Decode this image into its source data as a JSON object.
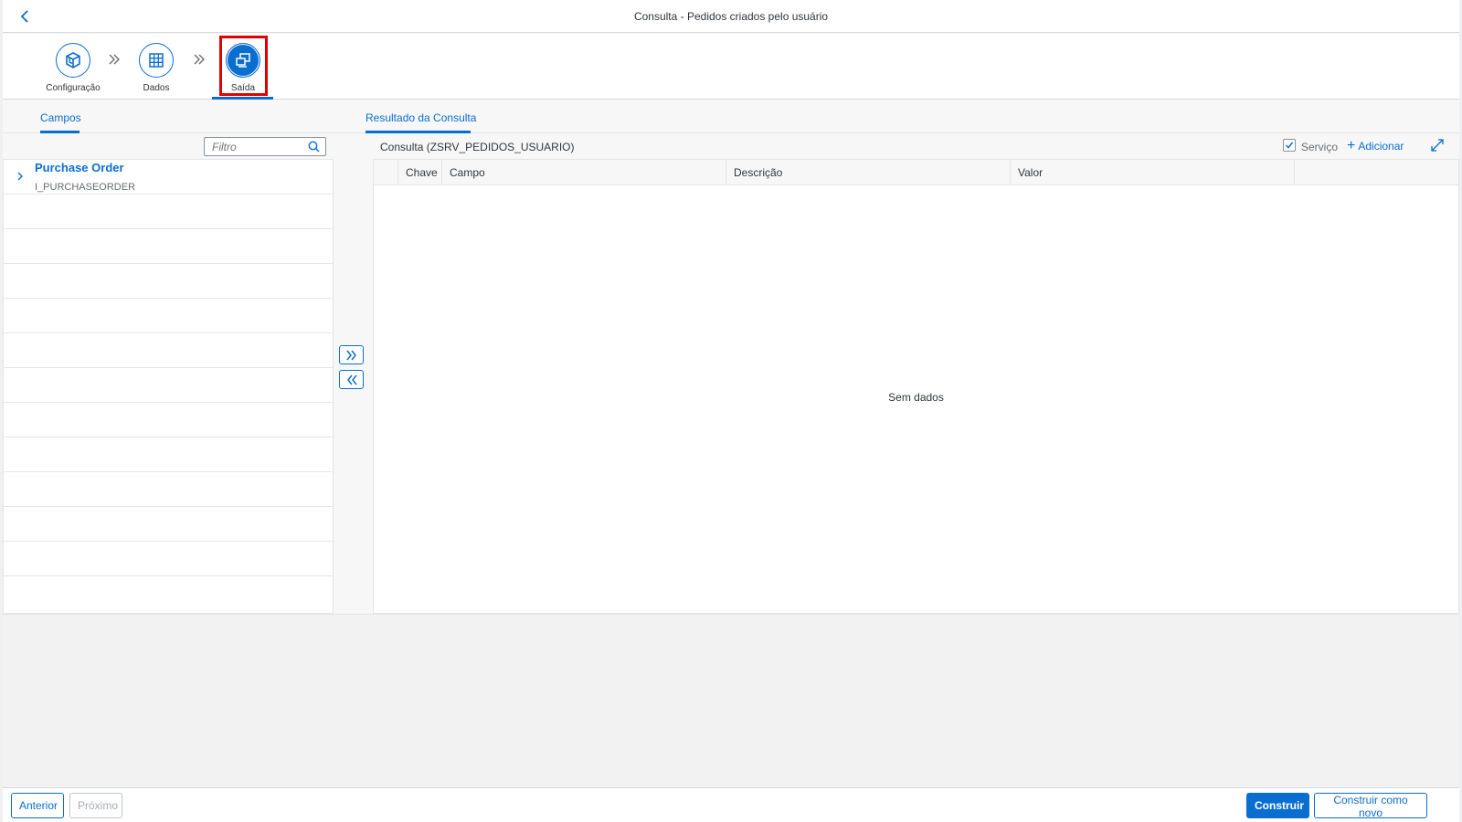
{
  "header": {
    "title": "Consulta - Pedidos criados pelo usuário",
    "back_icon": "chevron-left-icon"
  },
  "wizard": {
    "steps": [
      {
        "label": "Configuração",
        "icon": "cube-icon",
        "active": false
      },
      {
        "label": "Dados",
        "icon": "grid-icon",
        "active": false
      },
      {
        "label": "Saída",
        "icon": "output-icon",
        "active": true
      }
    ]
  },
  "tabs": {
    "left": "Campos",
    "right": "Resultado da Consulta"
  },
  "left_panel": {
    "filter_placeholder": "Filtro",
    "tree": [
      {
        "title": "Purchase Order",
        "subtitle": "I_PURCHASEORDER"
      }
    ]
  },
  "right_panel": {
    "title": "Consulta (ZSRV_PEDIDOS_USUARIO)",
    "service_checkbox_label": "Serviço",
    "service_checked": true,
    "add_label": "Adicionar",
    "columns": [
      "Chave",
      "Campo",
      "Descrição",
      "Valor"
    ],
    "no_data": "Sem dados"
  },
  "footer": {
    "previous": "Anterior",
    "next": "Próximo",
    "build": "Construir",
    "build_new": "Construir como novo"
  },
  "colors": {
    "accent": "#0a6ed1",
    "highlight": "#e00000"
  }
}
